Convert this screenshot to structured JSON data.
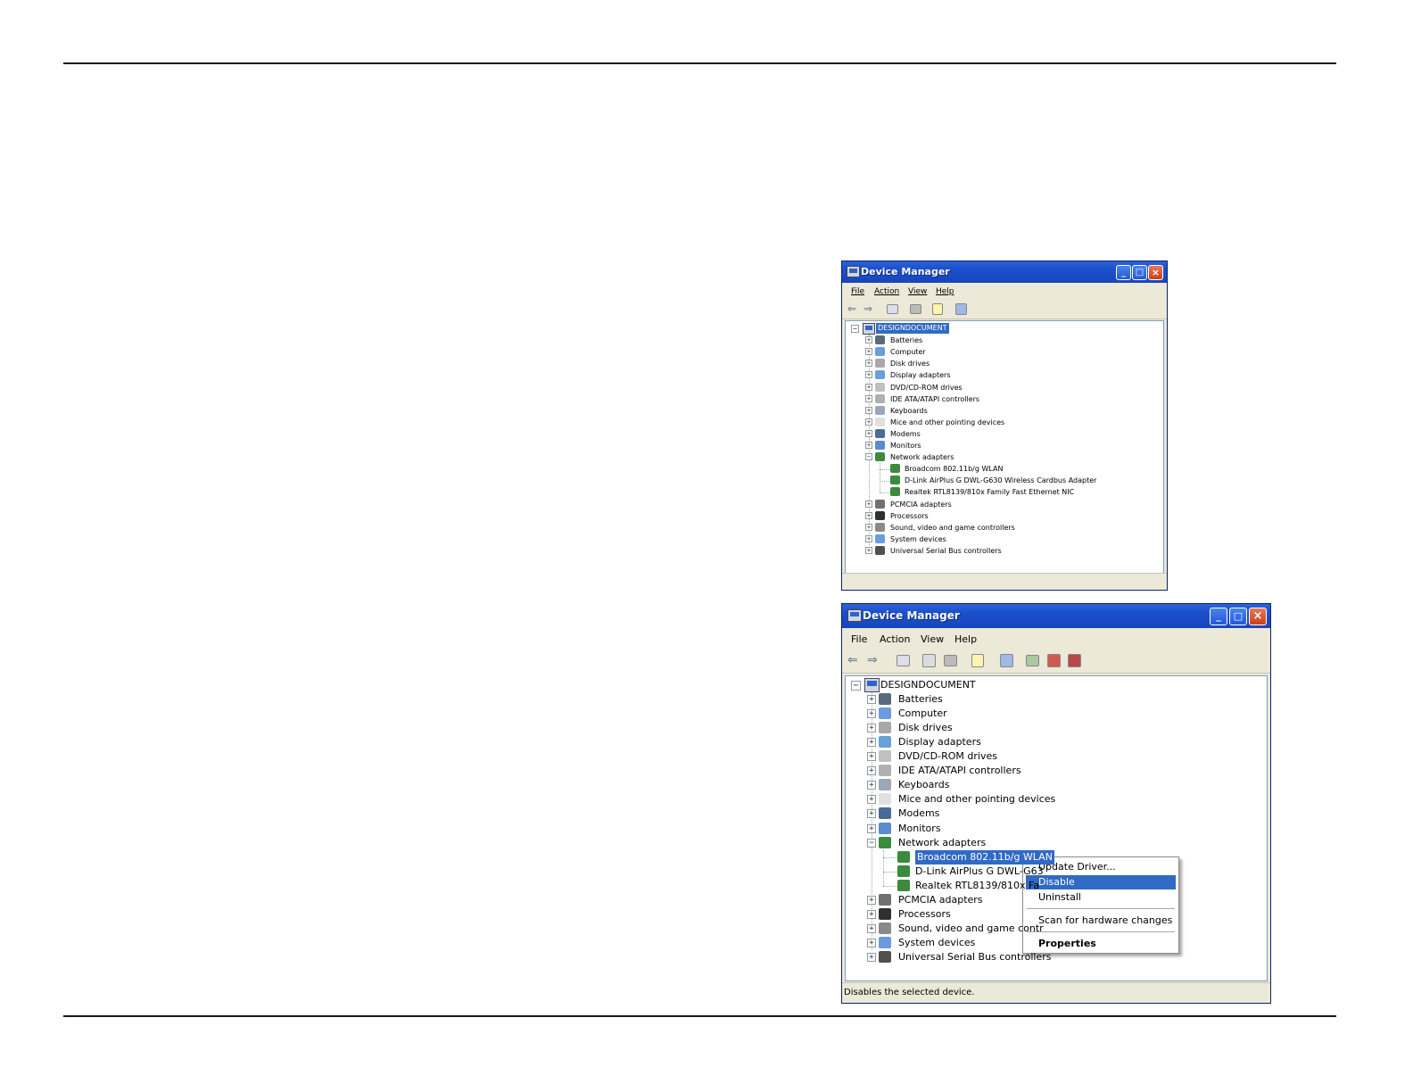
{
  "colors": {
    "title_bar": "#1c50cc",
    "selection": "#316ac5",
    "window_face": "#ece9d8",
    "close_button": "#c8401c"
  },
  "window1": {
    "title": "Device Manager",
    "menu": [
      "File",
      "Action",
      "View",
      "Help"
    ],
    "tree": {
      "root": "DESIGNDOCUMENT",
      "categories": [
        {
          "label": "Batteries",
          "icon": "battery-icon"
        },
        {
          "label": "Computer",
          "icon": "computer-icon"
        },
        {
          "label": "Disk drives",
          "icon": "disk-drive-icon"
        },
        {
          "label": "Display adapters",
          "icon": "display-adapter-icon"
        },
        {
          "label": "DVD/CD-ROM drives",
          "icon": "dvd-drive-icon"
        },
        {
          "label": "IDE ATA/ATAPI controllers",
          "icon": "ide-controller-icon"
        },
        {
          "label": "Keyboards",
          "icon": "keyboard-icon"
        },
        {
          "label": "Mice and other pointing devices",
          "icon": "mouse-icon"
        },
        {
          "label": "Modems",
          "icon": "modem-icon"
        },
        {
          "label": "Monitors",
          "icon": "monitor-icon"
        },
        {
          "label": "Network adapters",
          "icon": "network-adapter-icon",
          "expanded": true
        },
        {
          "label": "PCMCIA adapters",
          "icon": "pcmcia-icon"
        },
        {
          "label": "Processors",
          "icon": "processor-icon"
        },
        {
          "label": "Sound, video and game controllers",
          "icon": "sound-icon"
        },
        {
          "label": "System devices",
          "icon": "system-device-icon"
        },
        {
          "label": "Universal Serial Bus controllers",
          "icon": "usb-icon"
        }
      ],
      "network_children": [
        "Broadcom 802.11b/g WLAN",
        "D-Link AirPlus G DWL-G630 Wireless Cardbus Adapter",
        "Realtek RTL8139/810x Family Fast Ethernet NIC"
      ]
    },
    "status": ""
  },
  "window2": {
    "title": "Device Manager",
    "menu": [
      "File",
      "Action",
      "View",
      "Help"
    ],
    "tree": {
      "root": "DESIGNDOCUMENT",
      "categories": [
        {
          "label": "Batteries"
        },
        {
          "label": "Computer"
        },
        {
          "label": "Disk drives"
        },
        {
          "label": "Display adapters"
        },
        {
          "label": "DVD/CD-ROM drives"
        },
        {
          "label": "IDE ATA/ATAPI controllers"
        },
        {
          "label": "Keyboards"
        },
        {
          "label": "Mice and other pointing devices"
        },
        {
          "label": "Modems"
        },
        {
          "label": "Monitors"
        },
        {
          "label": "Network adapters",
          "expanded": true
        },
        {
          "label": "PCMCIA adapters"
        },
        {
          "label": "Processors"
        },
        {
          "label": "Sound, video and game contr"
        },
        {
          "label": "System devices"
        },
        {
          "label": "Universal Serial Bus controllers"
        }
      ],
      "network_children": [
        "Broadcom 802.11b/g WLAN",
        "D-Link AirPlus G DWL-G63",
        "Realtek RTL8139/810x Fa"
      ]
    },
    "context_menu": {
      "items": [
        "Update Driver...",
        "Disable",
        "Uninstall",
        "Scan for hardware changes",
        "Properties"
      ],
      "highlighted": "Disable"
    },
    "status": "Disables the selected device."
  }
}
